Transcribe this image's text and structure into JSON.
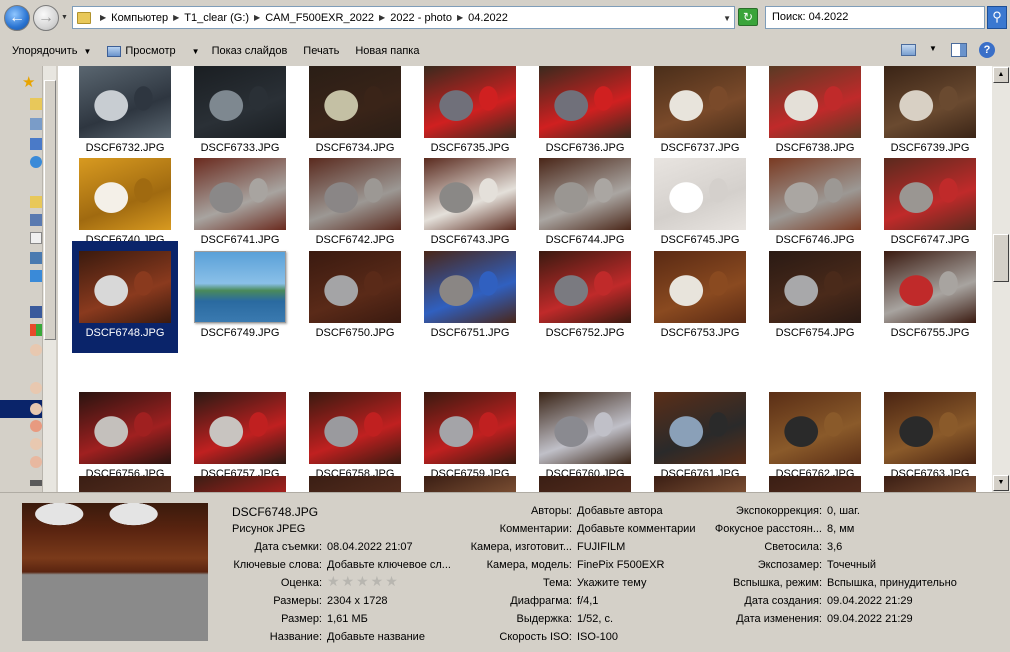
{
  "address": {
    "crumbs": [
      "Компьютер",
      "T1_clear (G:)",
      "CAM_F500EXR_2022",
      "2022 - photo",
      "04.2022"
    ],
    "search_value": "Поиск: 04.2022"
  },
  "toolbar": {
    "organize": "Упорядочить",
    "preview": "Просмотр",
    "slideshow": "Показ слайдов",
    "print": "Печать",
    "new_folder": "Новая папка"
  },
  "files": [
    {
      "name": "DSCF6732.JPG",
      "colors": [
        "#5a6670",
        "#c8cdd2",
        "#2e3640"
      ]
    },
    {
      "name": "DSCF6733.JPG",
      "colors": [
        "#1a1e22",
        "#7e8890",
        "#2a3036"
      ]
    },
    {
      "name": "DSCF6734.JPG",
      "colors": [
        "#2a1e16",
        "#c4c0a4",
        "#3a2418"
      ]
    },
    {
      "name": "DSCF6735.JPG",
      "colors": [
        "#3a2a1e",
        "#70707a",
        "#d02020"
      ]
    },
    {
      "name": "DSCF6736.JPG",
      "colors": [
        "#3a2a1e",
        "#70707a",
        "#d02020"
      ]
    },
    {
      "name": "DSCF6737.JPG",
      "colors": [
        "#4a2e1a",
        "#e8e4dc",
        "#7a4a2a"
      ]
    },
    {
      "name": "DSCF6738.JPG",
      "colors": [
        "#5a3a24",
        "#e4e0d8",
        "#c02a2a"
      ]
    },
    {
      "name": "DSCF6739.JPG",
      "colors": [
        "#3a2416",
        "#d8d0c4",
        "#6a4a30"
      ]
    },
    {
      "name": "DSCF6740.JPG",
      "colors": [
        "#d89a20",
        "#f4f0e8",
        "#a06a10"
      ]
    },
    {
      "name": "DSCF6741.JPG",
      "colors": [
        "#6a2a1e",
        "#8a8888",
        "#a8a4a0"
      ]
    },
    {
      "name": "DSCF6742.JPG",
      "colors": [
        "#5a2a1e",
        "#8a8686",
        "#9c9894"
      ]
    },
    {
      "name": "DSCF6743.JPG",
      "colors": [
        "#5a2a1e",
        "#8a8886",
        "#e4e0da"
      ]
    },
    {
      "name": "DSCF6744.JPG",
      "colors": [
        "#4a2618",
        "#9a9692",
        "#aaa6a2"
      ]
    },
    {
      "name": "DSCF6745.JPG",
      "colors": [
        "#e8e4e0",
        "#ffffff",
        "#d4d0cc"
      ]
    },
    {
      "name": "DSCF6746.JPG",
      "colors": [
        "#7a3a22",
        "#aaa6a2",
        "#9c9894"
      ]
    },
    {
      "name": "DSCF6747.JPG",
      "colors": [
        "#5a2a1e",
        "#9a9692",
        "#c02a2a"
      ]
    },
    {
      "name": "DSCF6748.JPG",
      "colors": [
        "#3a1a0e",
        "#d8d8d8",
        "#8a3a1e"
      ],
      "selected": true
    },
    {
      "name": "DSCF6749.JPG",
      "colors": [
        "#5aa0d8",
        "#8ac0e8",
        "#3a7ab0"
      ],
      "framed": true
    },
    {
      "name": "DSCF6750.JPG",
      "colors": [
        "#3a1a10",
        "#a4a4a6",
        "#5a2a18"
      ]
    },
    {
      "name": "DSCF6751.JPG",
      "colors": [
        "#4a2618",
        "#8a8684",
        "#3060c0"
      ]
    },
    {
      "name": "DSCF6752.JPG",
      "colors": [
        "#3a1a10",
        "#7a7a80",
        "#c02a2a"
      ]
    },
    {
      "name": "DSCF6753.JPG",
      "colors": [
        "#5a2a14",
        "#e8e4dc",
        "#8a4a20"
      ]
    },
    {
      "name": "DSCF6754.JPG",
      "colors": [
        "#2a1a14",
        "#a8a8aa",
        "#4a2a1a"
      ]
    },
    {
      "name": "DSCF6755.JPG",
      "colors": [
        "#3a1a10",
        "#c02a2a",
        "#a8a4a0"
      ]
    },
    {
      "name": "DSCF6756.JPG",
      "colors": [
        "#2a1410",
        "#c4c0bc",
        "#a02020"
      ]
    },
    {
      "name": "DSCF6757.JPG",
      "colors": [
        "#2a1a14",
        "#c8c4c0",
        "#c02020"
      ]
    },
    {
      "name": "DSCF6758.JPG",
      "colors": [
        "#3a1a10",
        "#9a9a9e",
        "#c02020"
      ]
    },
    {
      "name": "DSCF6759.JPG",
      "colors": [
        "#3a1a10",
        "#a4a4a8",
        "#c02020"
      ]
    },
    {
      "name": "DSCF6760.JPG",
      "colors": [
        "#3a2416",
        "#8a8a90",
        "#c0c0c8"
      ]
    },
    {
      "name": "DSCF6761.JPG",
      "colors": [
        "#5a2e18",
        "#8aa0b8",
        "#2a2a2a"
      ]
    },
    {
      "name": "DSCF6762.JPG",
      "colors": [
        "#5a2e16",
        "#2a2a2a",
        "#8a5a2a"
      ]
    },
    {
      "name": "DSCF6763.JPG",
      "colors": [
        "#4a2412",
        "#2a2a2a",
        "#8a5a2a"
      ]
    },
    {
      "name": "",
      "colors": [
        "#3a1e14",
        "#c8c4c0",
        "#5a3020"
      ]
    },
    {
      "name": "",
      "colors": [
        "#3a1e14",
        "#b8b8b8",
        "#c02020"
      ]
    },
    {
      "name": "",
      "colors": [
        "#3a1e14",
        "#d8d4d0",
        "#5a3020"
      ]
    },
    {
      "name": "",
      "colors": [
        "#3a1e14",
        "#e4e0dc",
        "#8a5a3a"
      ]
    },
    {
      "name": "",
      "colors": [
        "#3a1e14",
        "#8a8a8a",
        "#5a3020"
      ]
    },
    {
      "name": "",
      "colors": [
        "#3a1e14",
        "#d8d4d0",
        "#8a5a3a"
      ]
    },
    {
      "name": "",
      "colors": [
        "#3a1e14",
        "#c8c4c0",
        "#5a3020"
      ]
    },
    {
      "name": "",
      "colors": [
        "#3a1e14",
        "#d8d4d0",
        "#8a5a3a"
      ]
    }
  ],
  "details": {
    "file_name": "DSCF6748.JPG",
    "file_type": "Рисунок JPEG",
    "thumb_colors": [
      "#e4e4e4",
      "#5a2410",
      "#8a8a8a"
    ],
    "col1": [
      {
        "label": "Дата съемки:",
        "value": "08.04.2022 21:07"
      },
      {
        "label": "Ключевые слова:",
        "value": "Добавьте ключевое сл..."
      },
      {
        "label": "Оценка:",
        "value": ""
      },
      {
        "label": "Размеры:",
        "value": "2304 x 1728"
      },
      {
        "label": "Размер:",
        "value": "1,61 МБ"
      },
      {
        "label": "Название:",
        "value": "Добавьте название"
      }
    ],
    "col2": [
      {
        "label": "Авторы:",
        "value": "Добавьте автора"
      },
      {
        "label": "Комментарии:",
        "value": "Добавьте комментарии"
      },
      {
        "label": "Камера, изготовит...",
        "value": "FUJIFILM"
      },
      {
        "label": "Камера, модель:",
        "value": "FinePix F500EXR"
      },
      {
        "label": "Тема:",
        "value": "Укажите тему"
      },
      {
        "label": "Диафрагма:",
        "value": "f/4,1"
      },
      {
        "label": "Выдержка:",
        "value": "1/52, с."
      },
      {
        "label": "Скорость ISO:",
        "value": "ISO-100"
      }
    ],
    "col3": [
      {
        "label": "Экспокоррекция:",
        "value": "0, шаг."
      },
      {
        "label": "Фокусное расстоян...",
        "value": "8, мм"
      },
      {
        "label": "Светосила:",
        "value": "3,6"
      },
      {
        "label": "Экспозамер:",
        "value": "Точечный"
      },
      {
        "label": "Вспышка, режим:",
        "value": "Вспышка, принудительно"
      },
      {
        "label": "Дата создания:",
        "value": "09.04.2022 21:29"
      },
      {
        "label": "Дата изменения:",
        "value": "09.04.2022 21:29"
      }
    ],
    "rating_stars": "★★★★★"
  }
}
